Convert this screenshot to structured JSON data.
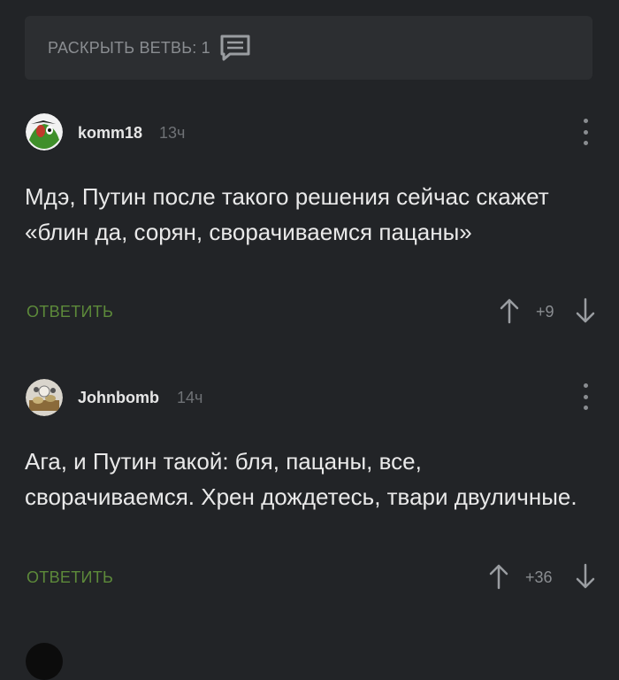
{
  "expand_bar": {
    "label": "РАСКРЫТЬ ВЕТВЬ: 1",
    "icon": "comment-bubble-icon"
  },
  "comments": [
    {
      "username": "komm18",
      "time": "13ч",
      "text": "Мдэ, Путин после такого решения сейчас скажет «блин да, сорян, сворачиваемся пацаны»",
      "reply_label": "ОТВЕТИТЬ",
      "rating": "+9"
    },
    {
      "username": "Johnbomb",
      "time": "14ч",
      "text": "Ага, и Путин такой: бля, пацаны, все, сворачиваемся. Хрен дождетесь, твари двуличные.",
      "reply_label": "ОТВЕТИТЬ",
      "rating": "+36"
    }
  ],
  "colors": {
    "background": "#222427",
    "reply": "#5d8a3a",
    "muted": "#8a8d91"
  }
}
